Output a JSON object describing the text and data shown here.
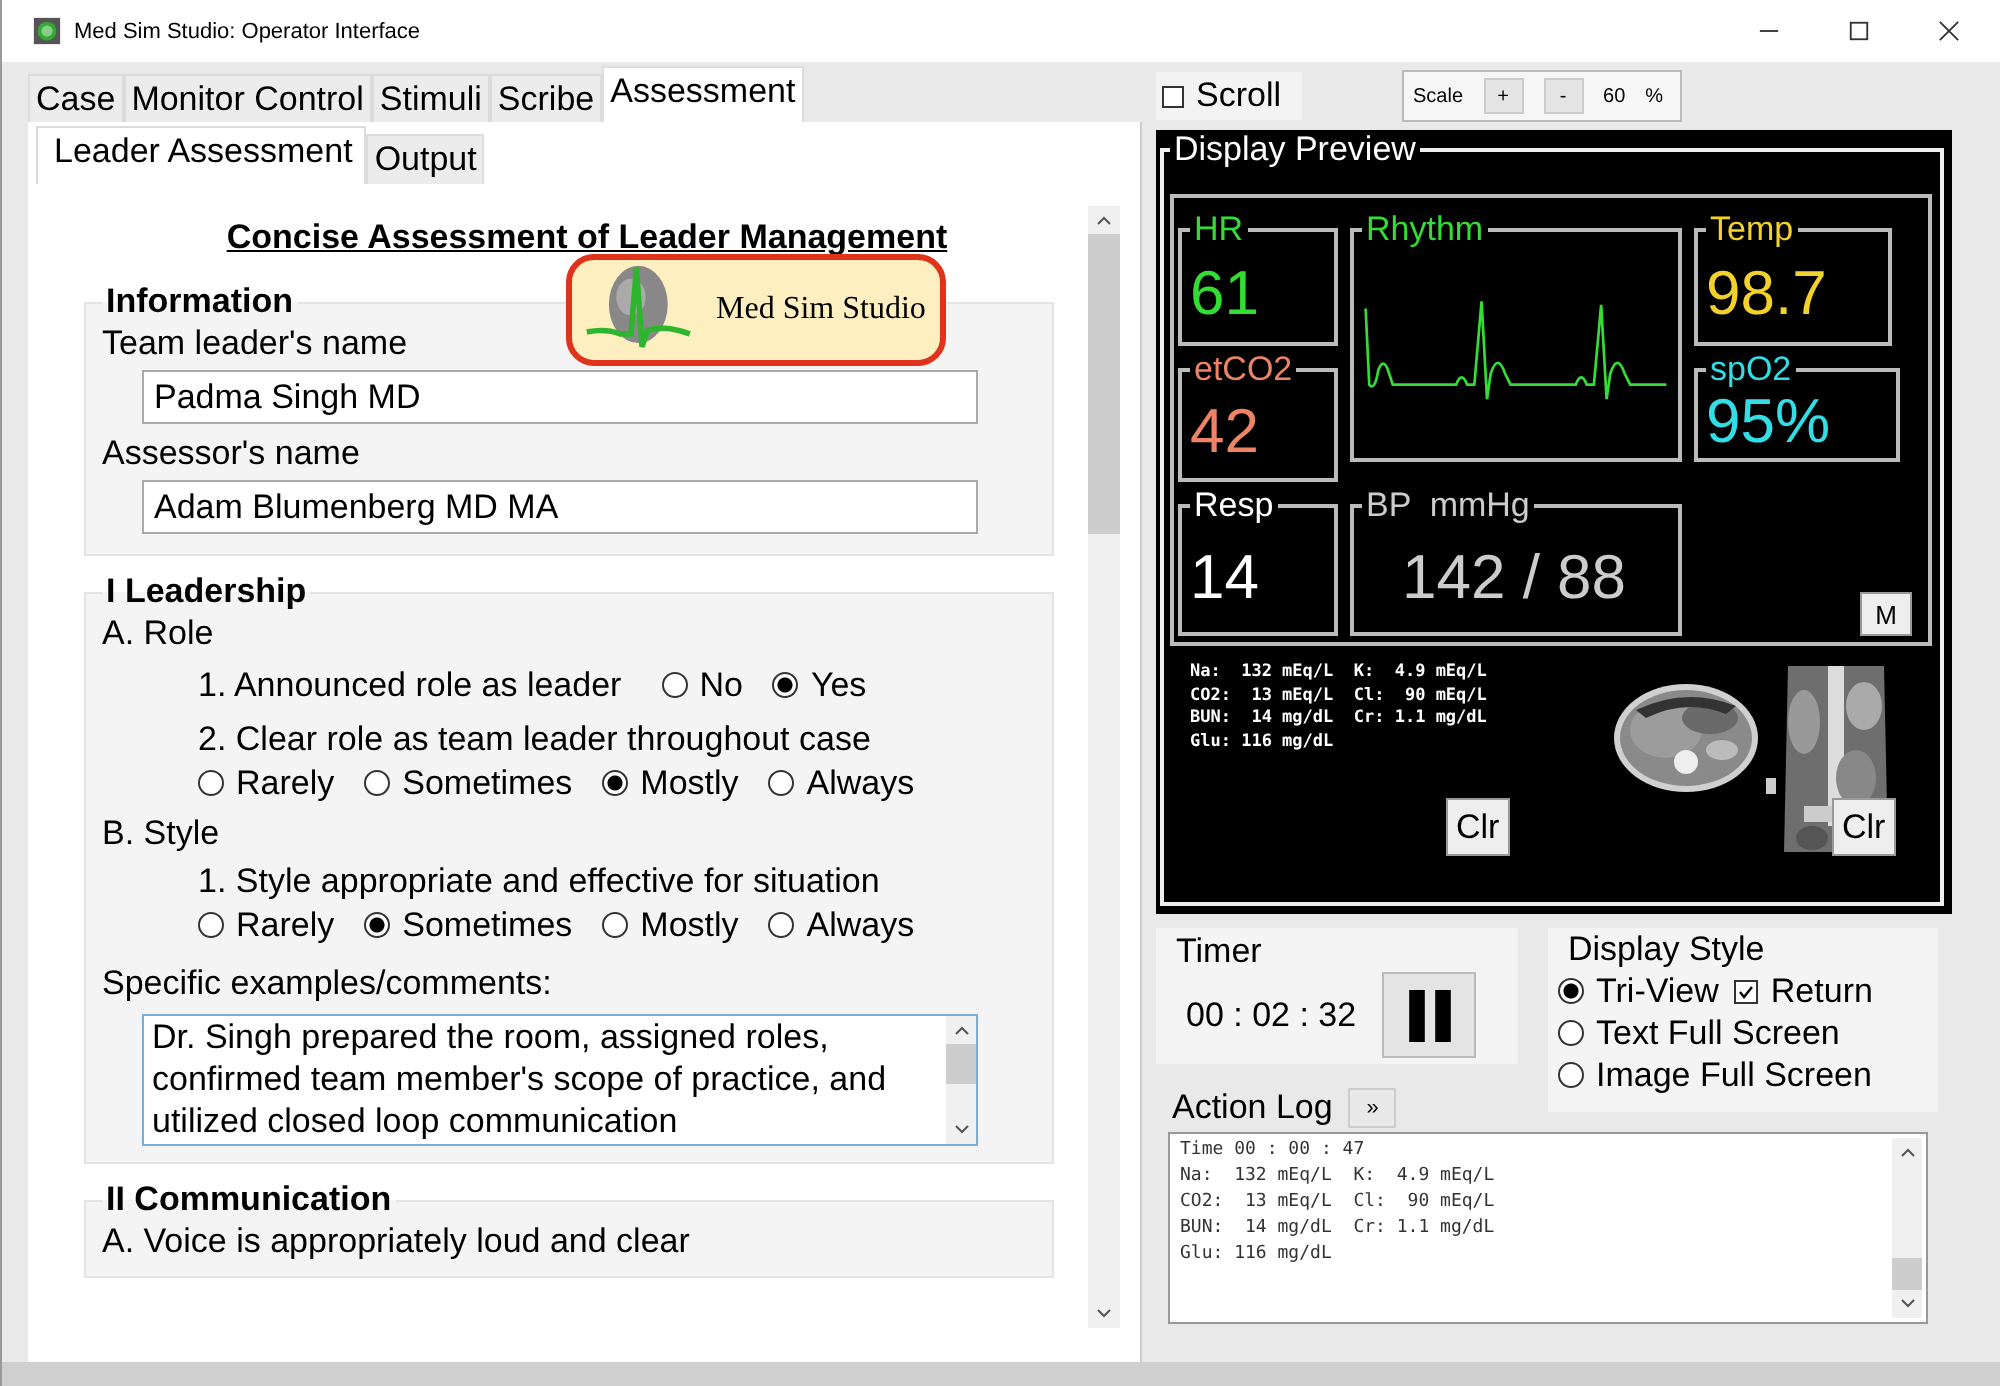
{
  "window": {
    "title": "Med Sim Studio: Operator Interface"
  },
  "tabs": [
    {
      "label": "Case",
      "selected": false
    },
    {
      "label": "Monitor Control",
      "selected": false
    },
    {
      "label": "Stimuli",
      "selected": false
    },
    {
      "label": "Scribe",
      "selected": false
    },
    {
      "label": "Assessment",
      "selected": true
    }
  ],
  "subtabs": [
    {
      "label": "Leader Assessment",
      "selected": true
    },
    {
      "label": "Output",
      "selected": false
    }
  ],
  "form": {
    "title": "Concise Assessment of Leader Management",
    "logo_text": "Med Sim Studio",
    "information": {
      "heading": "Information",
      "fields": [
        {
          "label": "Team leader's name",
          "value": "Padma Singh MD"
        },
        {
          "label": "Assessor's name",
          "value": "Adam Blumenberg MD MA"
        }
      ]
    },
    "sections": [
      {
        "heading": "I Leadership",
        "groups": [
          {
            "heading": "A. Role",
            "items": [
              {
                "question": "1. Announced role as leader",
                "kind": "inline",
                "options": [
                  {
                    "label": "No",
                    "selected": false
                  },
                  {
                    "label": "Yes",
                    "selected": true
                  }
                ]
              },
              {
                "question": "2. Clear role as team leader throughout case",
                "kind": "below",
                "options": [
                  {
                    "label": "Rarely",
                    "selected": false
                  },
                  {
                    "label": "Sometimes",
                    "selected": false
                  },
                  {
                    "label": "Mostly",
                    "selected": true
                  },
                  {
                    "label": "Always",
                    "selected": false
                  }
                ]
              }
            ]
          },
          {
            "heading": "B. Style",
            "items": [
              {
                "question": "1. Style appropriate and effective for situation",
                "kind": "below",
                "options": [
                  {
                    "label": "Rarely",
                    "selected": false
                  },
                  {
                    "label": "Sometimes",
                    "selected": true
                  },
                  {
                    "label": "Mostly",
                    "selected": false
                  },
                  {
                    "label": "Always",
                    "selected": false
                  }
                ]
              }
            ]
          }
        ],
        "comments_label": "Specific examples/comments:",
        "comments": "Dr. Singh prepared the room, assigned roles, confirmed team member's scope of practice, and utilized closed loop communication"
      },
      {
        "heading": "II Communication",
        "groups": [
          {
            "heading": "A. Voice is appropriately loud and clear"
          }
        ]
      }
    ]
  },
  "scroll": {
    "label": "Scroll",
    "checked": false
  },
  "scale": {
    "label": "Scale",
    "plus": "+",
    "minus": "-",
    "value": "60",
    "unit": "%"
  },
  "preview": {
    "title": "Display Preview",
    "vitals": [
      {
        "label": "HR",
        "value": "61",
        "color": "#33dd33"
      },
      {
        "label": "etCO2",
        "value": "42",
        "color": "#ee8466"
      },
      {
        "label": "Resp",
        "value": "14",
        "color": "#ffffff"
      },
      {
        "label": "Temp",
        "value": "98.7",
        "color": "#f2d22a"
      },
      {
        "label": "spO2",
        "value": "95%",
        "color": "#33dde6"
      }
    ],
    "rhythm": {
      "label": "Rhythm",
      "color": "#33dd33"
    },
    "bp": {
      "label": "BP  mmHg",
      "value": "142 / 88",
      "color": "#cccccc"
    },
    "m_button": "M",
    "labs": [
      "Na:  132 mEq/L  K:  4.9 mEq/L",
      "CO2:  13 mEq/L  Cl:  90 mEq/L",
      "BUN:  14 mg/dL  Cr: 1.1 mg/dL",
      "Glu: 116 mg/dL"
    ],
    "clear_buttons": [
      "Clr",
      "Clr"
    ]
  },
  "timer": {
    "title": "Timer",
    "time": "00 : 02 : 32"
  },
  "display_style": {
    "title": "Display Style",
    "options": [
      {
        "label": "Tri-View",
        "selected": true
      },
      {
        "label": "Text Full Screen",
        "selected": false
      },
      {
        "label": "Image Full Screen",
        "selected": false
      }
    ],
    "return": {
      "label": "Return",
      "checked": true
    }
  },
  "action_log": {
    "title": "Action Log",
    "expand": "»",
    "lines": [
      "Time 00 : 00 : 47",
      "Na:  132 mEq/L  K:  4.9 mEq/L",
      "CO2:  13 mEq/L  Cl:  90 mEq/L",
      "BUN:  14 mg/dL  Cr: 1.1 mg/dL",
      "Glu: 116 mg/dL"
    ]
  }
}
